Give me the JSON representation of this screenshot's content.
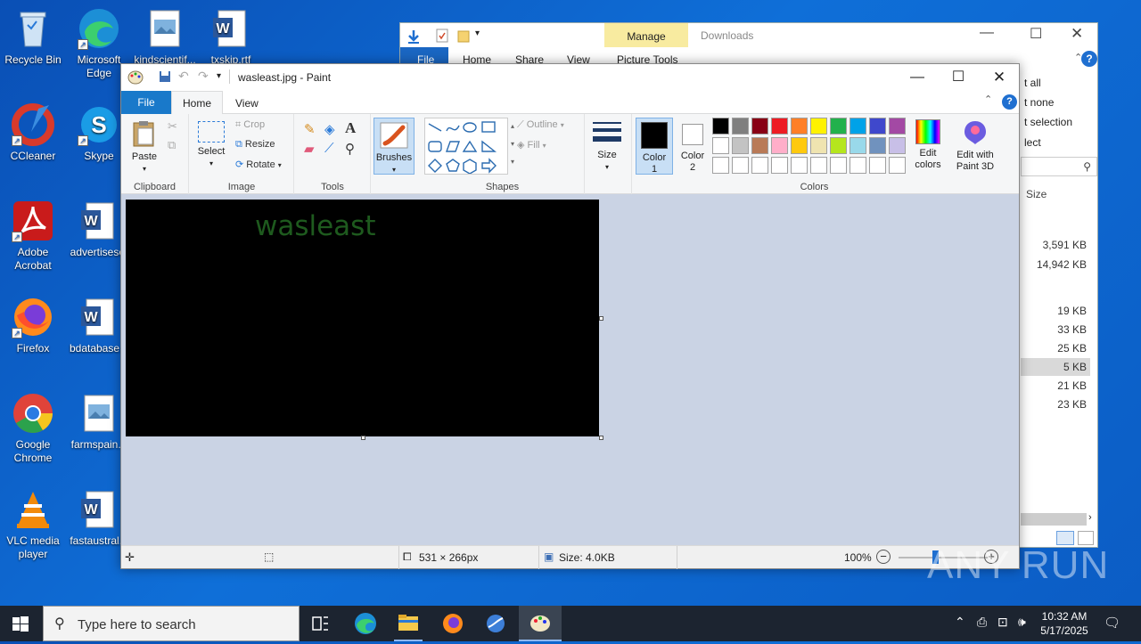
{
  "desktop": {
    "icons": [
      {
        "label": "Recycle Bin"
      },
      {
        "label": "Microsoft Edge"
      },
      {
        "label": "kindscientif..."
      },
      {
        "label": "txskip.rtf"
      },
      {
        "label": "CCleaner"
      },
      {
        "label": "Skype"
      },
      {
        "label": "Adobe Acrobat"
      },
      {
        "label": "advertiseset"
      },
      {
        "label": "Firefox"
      },
      {
        "label": "bdatabase..."
      },
      {
        "label": "Google Chrome"
      },
      {
        "label": "farmspain..."
      },
      {
        "label": "VLC media player"
      },
      {
        "label": "fastaustral..."
      }
    ]
  },
  "explorer": {
    "title": "Downloads",
    "manage": "Manage",
    "tabs": [
      "File",
      "Home",
      "Share",
      "View",
      "Picture Tools"
    ],
    "menu_partial": [
      "t all",
      "t none",
      "t selection",
      "lect"
    ],
    "size_header": "Size",
    "sizes": [
      "3,591 KB",
      "14,942 KB",
      "19 KB",
      "33 KB",
      "25 KB",
      "5 KB",
      "21 KB",
      "23 KB"
    ]
  },
  "paint": {
    "title": "wasleast.jpg - Paint",
    "menu": {
      "file": "File",
      "home": "Home",
      "view": "View"
    },
    "ribbon": {
      "paste": "Paste",
      "clipboard": "Clipboard",
      "select": "Select",
      "crop": "Crop",
      "resize": "Resize",
      "rotate": "Rotate",
      "image": "Image",
      "tools": "Tools",
      "brushes": "Brushes",
      "outline": "Outline",
      "fill": "Fill",
      "shapes": "Shapes",
      "size": "Size",
      "color1": "Color 1",
      "color2": "Color 2",
      "colors": "Colors",
      "edit_colors": "Edit colors",
      "edit_paint3d": "Edit with Paint 3D"
    },
    "palette": [
      "#000000",
      "#7f7f7f",
      "#880015",
      "#ed1c24",
      "#ff7f27",
      "#fff200",
      "#22b14c",
      "#00a2e8",
      "#3f48cc",
      "#a349a4",
      "#ffffff",
      "#c3c3c3",
      "#b97a57",
      "#ffaec9",
      "#ffc90e",
      "#efe4b0",
      "#b5e61d",
      "#99d9ea",
      "#7092be",
      "#c8bfe7"
    ],
    "canvas_text": "wasleast",
    "status": {
      "dimensions": "531 × 266px",
      "size": "Size: 4.0KB",
      "zoom": "100%"
    }
  },
  "taskbar": {
    "search_placeholder": "Type here to search",
    "time": "10:32 AM",
    "date": "5/17/2025"
  },
  "watermark": "ANY RUN"
}
